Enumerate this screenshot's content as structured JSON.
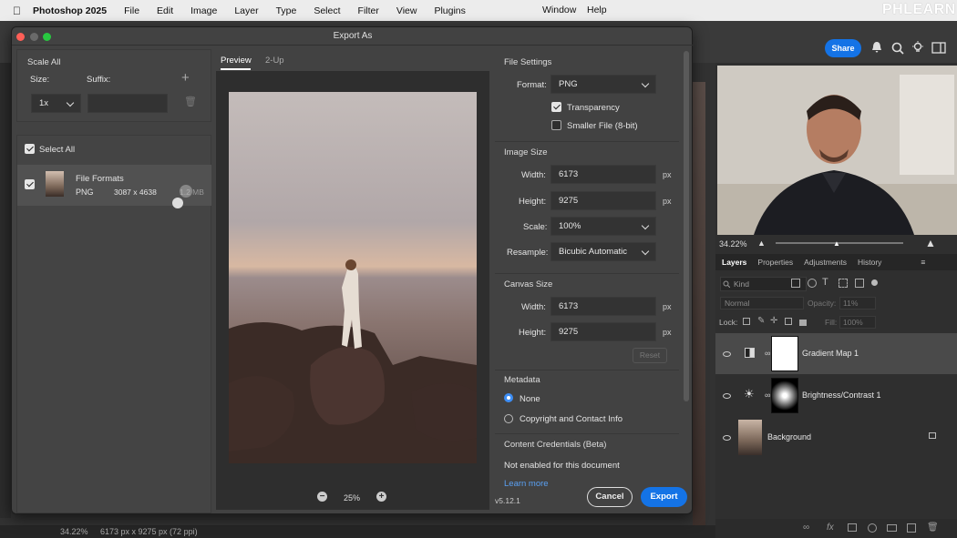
{
  "menubar": {
    "app": "Photoshop 2025",
    "items": [
      "File",
      "Edit",
      "Image",
      "Layer",
      "Type",
      "Select",
      "Filter",
      "View",
      "Plugins"
    ],
    "window": "Window",
    "help": "Help",
    "brand": "PHLEARN"
  },
  "toolbar": {
    "share": "Share"
  },
  "dialog": {
    "title": "Export As",
    "scale_all": {
      "header": "Scale All",
      "size_label": "Size:",
      "suffix_label": "Suffix:",
      "size_value": "1x",
      "suffix_value": ""
    },
    "select_all": "Select All",
    "file_item": {
      "name": "File Formats",
      "format": "PNG",
      "dims": "3087 x 4638",
      "size": "1.2 MB"
    },
    "tabs": [
      "Preview",
      "2-Up"
    ],
    "zoom": "25%",
    "file_settings": {
      "header": "File Settings",
      "format_label": "Format:",
      "format_value": "PNG",
      "transparency": "Transparency",
      "smaller_file": "Smaller File (8-bit)"
    },
    "image_size": {
      "header": "Image Size",
      "width_label": "Width:",
      "width": "6173",
      "height_label": "Height:",
      "height": "9275",
      "unit": "px",
      "scale_label": "Scale:",
      "scale": "100%",
      "resample_label": "Resample:",
      "resample": "Bicubic Automatic"
    },
    "canvas_size": {
      "header": "Canvas Size",
      "width_label": "Width:",
      "width": "6173",
      "height_label": "Height:",
      "height": "9275",
      "unit": "px",
      "reset": "Reset"
    },
    "metadata": {
      "header": "Metadata",
      "none": "None",
      "copyright": "Copyright and Contact Info"
    },
    "credentials": {
      "header": "Content Credentials (Beta)",
      "status": "Not enabled for this document",
      "learn_more": "Learn more"
    },
    "version": "v5.12.1",
    "cancel": "Cancel",
    "export": "Export"
  },
  "panel": {
    "zoom": "34.22%",
    "tabs": [
      "Layers",
      "Properties",
      "Adjustments",
      "History"
    ],
    "kind": "Kind",
    "blend": "Normal",
    "opacity_label": "Opacity:",
    "opacity": "11%",
    "lock_label": "Lock:",
    "fill_label": "Fill:",
    "fill": "100%",
    "layers": [
      "Gradient Map 1",
      "Brightness/Contrast 1",
      "Background"
    ]
  },
  "status": {
    "zoom": "34.22%",
    "dims": "6173 px x 9275 px (72 ppi)"
  }
}
